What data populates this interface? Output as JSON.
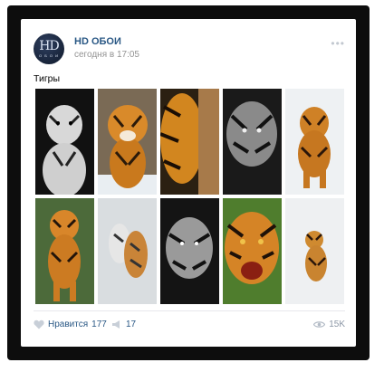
{
  "post": {
    "author": "HD ОБОИ",
    "time": "сегодня в 17:05",
    "text": "Тигры",
    "avatar_text": "HD",
    "avatar_subtext": "О Б О И"
  },
  "footer": {
    "like_label": "Нравится",
    "like_count": "177",
    "share_count": "17",
    "views": "15K"
  },
  "photos": [
    "tiger-photo-1",
    "tiger-photo-2",
    "tiger-photo-3",
    "tiger-photo-4",
    "tiger-photo-5",
    "tiger-photo-6",
    "tiger-photo-7",
    "tiger-photo-8",
    "tiger-photo-9",
    "tiger-photo-10"
  ],
  "colors": {
    "link": "#2a5885",
    "muted": "#939393",
    "frame": "#0d0d0d"
  }
}
